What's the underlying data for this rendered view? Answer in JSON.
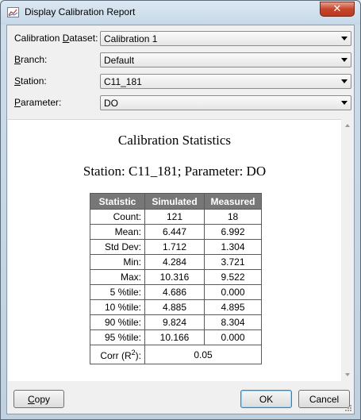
{
  "window": {
    "title": "Display Calibration Report",
    "close_glyph": "✕"
  },
  "fields": {
    "dataset": {
      "label_pre": "Calibration ",
      "label_u": "D",
      "label_post": "ataset:",
      "value": "Calibration 1"
    },
    "branch": {
      "label_pre": "",
      "label_u": "B",
      "label_post": "ranch:",
      "value": "Default"
    },
    "station": {
      "label_pre": "",
      "label_u": "S",
      "label_post": "tation:",
      "value": "C11_181"
    },
    "parameter": {
      "label_pre": "",
      "label_u": "P",
      "label_post": "arameter:",
      "value": "DO"
    }
  },
  "report": {
    "title": "Calibration Statistics",
    "subtitle": "Station: C11_181; Parameter: DO",
    "headers": {
      "statistic": "Statistic",
      "simulated": "Simulated",
      "measured": "Measured"
    },
    "rows": [
      {
        "stat": "Count:",
        "sim": "121",
        "meas": "18"
      },
      {
        "stat": "Mean:",
        "sim": "6.447",
        "meas": "6.992"
      },
      {
        "stat": "Std Dev:",
        "sim": "1.712",
        "meas": "1.304"
      },
      {
        "stat": "Min:",
        "sim": "4.284",
        "meas": "3.721"
      },
      {
        "stat": "Max:",
        "sim": "10.316",
        "meas": "9.522"
      },
      {
        "stat": "5 %tile:",
        "sim": "4.686",
        "meas": "0.000"
      },
      {
        "stat": "10 %tile:",
        "sim": "4.885",
        "meas": "4.895"
      },
      {
        "stat": "90 %tile:",
        "sim": "9.824",
        "meas": "8.304"
      },
      {
        "stat": "95 %tile:",
        "sim": "10.166",
        "meas": "0.000"
      }
    ],
    "corr": {
      "label_pre": "Corr (R",
      "label_sup": "2",
      "label_post": "):",
      "value": "0.05"
    }
  },
  "buttons": {
    "copy": {
      "u": "C",
      "rest": "opy"
    },
    "ok": "OK",
    "cancel": "Cancel"
  },
  "icons": [
    "chart-icon",
    "close-icon",
    "chevron-down-icon",
    "scroll-up-icon",
    "scroll-down-icon",
    "resize-grip-icon"
  ]
}
